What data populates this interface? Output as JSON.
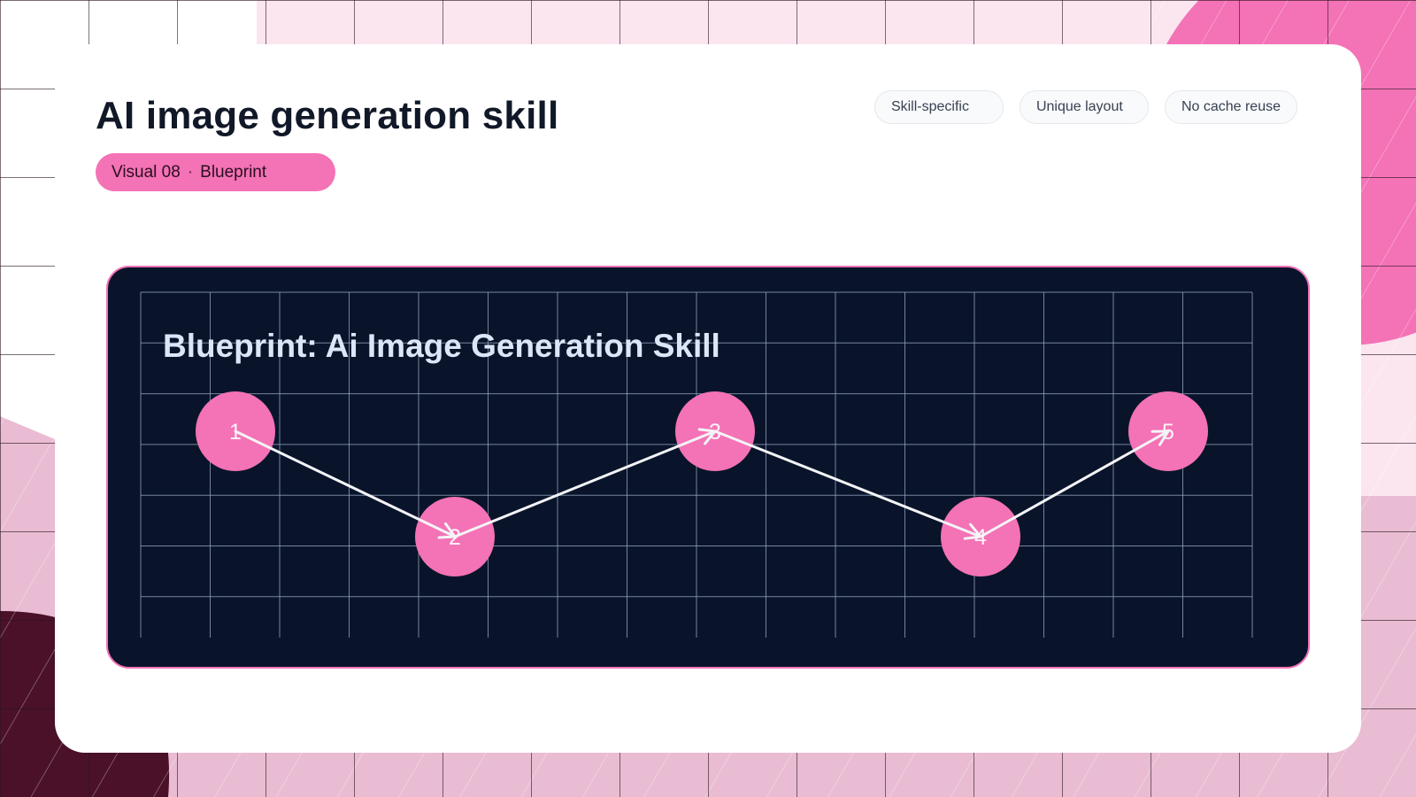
{
  "header": {
    "title": "AI image generation skill",
    "visual_number": "Visual 08",
    "visual_separator": "·",
    "visual_name": "Blueprint"
  },
  "tags": [
    "Skill-specific",
    "Unique layout",
    "No cache reuse"
  ],
  "diagram": {
    "title": "Blueprint: Ai Image Generation Skill",
    "nodes": [
      "1",
      "2",
      "3",
      "4",
      "5"
    ],
    "connections": [
      [
        1,
        2
      ],
      [
        2,
        3
      ],
      [
        3,
        4
      ],
      [
        4,
        5
      ]
    ]
  },
  "colors": {
    "accent": "#f472b6",
    "panel": "#09142b",
    "panel_text": "#dbe7f7",
    "connector": "#f3f4f6",
    "title": "#111827"
  }
}
